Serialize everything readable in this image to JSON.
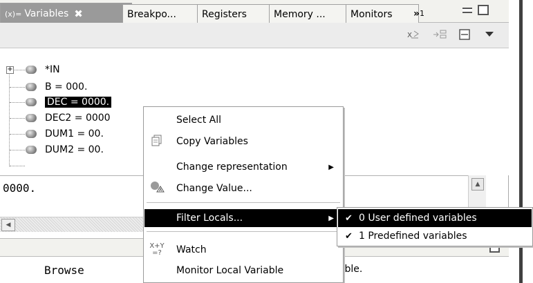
{
  "tabs": [
    {
      "label": "Variables",
      "active": true,
      "icon": "variables-icon"
    },
    {
      "label": "Breakpo..."
    },
    {
      "label": "Registers"
    },
    {
      "label": "Memory ..."
    },
    {
      "label": "Monitors"
    }
  ],
  "overflow": {
    "chevron": "»",
    "count": "1"
  },
  "close_glyph": "✖",
  "toolbar": {
    "icons": [
      "show-type-names-icon",
      "collapse-all-icon",
      "layout-icon",
      "view-menu-icon"
    ]
  },
  "tree": {
    "items": [
      {
        "label": "*IN",
        "expandable": true
      },
      {
        "label": "B = 000."
      },
      {
        "label": "DEC = 0000.",
        "selected": true
      },
      {
        "label": "DEC2 = 0000"
      },
      {
        "label": "DUM1 = 00."
      },
      {
        "label": "DUM2 = 00."
      }
    ]
  },
  "details": {
    "value": "0000."
  },
  "context_menu": {
    "items": [
      {
        "label": "Select All",
        "icon": ""
      },
      {
        "label": "Copy Variables",
        "icon": "copy-icon"
      },
      {
        "label": "Change representation",
        "icon": "",
        "submenu": true
      },
      {
        "label": "Change Value...",
        "icon": "change-value-icon"
      },
      {
        "label": "Filter Locals...",
        "icon": "",
        "submenu": true,
        "highlighted": true
      },
      {
        "label": "Watch",
        "icon": "watch-expression-icon"
      },
      {
        "label": "Monitor Local Variable",
        "icon": ""
      }
    ]
  },
  "submenu": {
    "items": [
      {
        "label": "0 User defined variables",
        "checked": true,
        "highlighted": true
      },
      {
        "label": "1 Predefined variables",
        "checked": true
      }
    ]
  },
  "lower_view": {
    "browse": "Browse",
    "trailing_text": "iable."
  },
  "colors": {
    "selection": "#000000",
    "tab_active": "#9a9a9a",
    "toolbar": "#ececec"
  }
}
